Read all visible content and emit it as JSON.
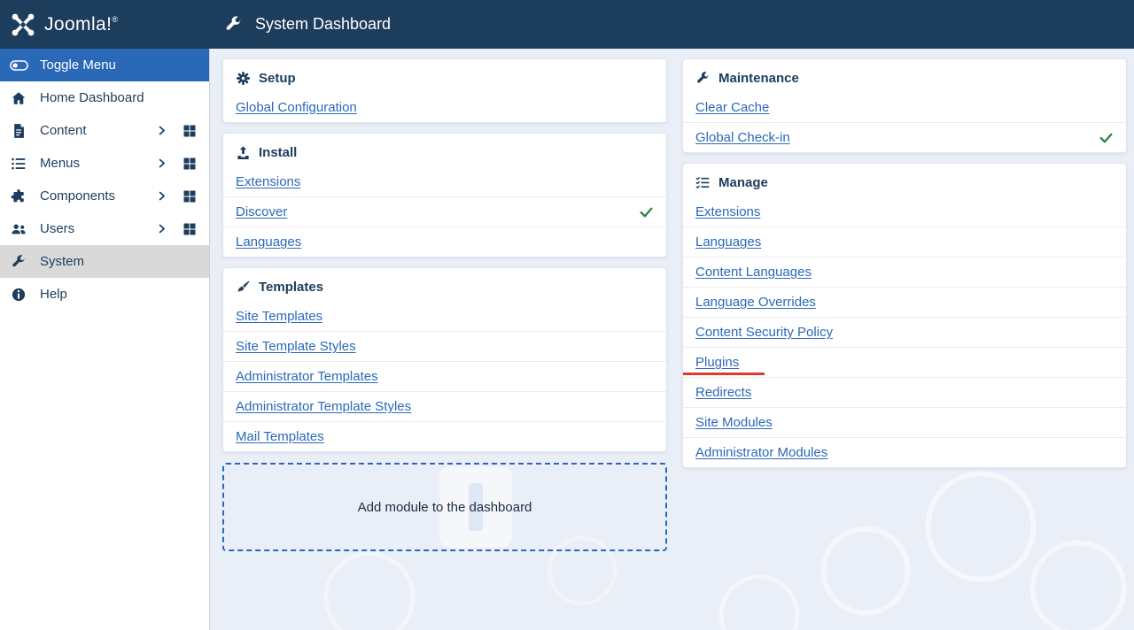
{
  "colors": {
    "navy": "#1c3d5c",
    "accent_blue": "#2a69b8",
    "success_green": "#2f8540",
    "annotation_red": "#df3a2b",
    "page_background": "#e9eef7",
    "active_item_gray": "#d9d9d9"
  },
  "header": {
    "logo_text": "Joomla!",
    "logo_reg": "®",
    "title": "System Dashboard",
    "title_icon": "wrench-icon"
  },
  "sidebar": {
    "items": [
      {
        "label": "Toggle Menu",
        "icon": "toggle-icon"
      },
      {
        "label": "Home Dashboard",
        "icon": "home-icon"
      },
      {
        "label": "Content",
        "icon": "document-icon",
        "has_submenu": true
      },
      {
        "label": "Menus",
        "icon": "list-icon",
        "has_submenu": true
      },
      {
        "label": "Components",
        "icon": "puzzle-icon",
        "has_submenu": true
      },
      {
        "label": "Users",
        "icon": "users-icon",
        "has_submenu": true
      },
      {
        "label": "System",
        "icon": "wrench-icon",
        "active": true
      },
      {
        "label": "Help",
        "icon": "info-icon"
      }
    ]
  },
  "panels": {
    "setup": {
      "title": "Setup",
      "icon": "gear-icon",
      "links": [
        {
          "label": "Global Configuration"
        }
      ]
    },
    "install": {
      "title": "Install",
      "icon": "upload-icon",
      "links": [
        {
          "label": "Extensions"
        },
        {
          "label": "Discover",
          "checked": true
        },
        {
          "label": "Languages"
        }
      ]
    },
    "templates": {
      "title": "Templates",
      "icon": "brush-icon",
      "links": [
        {
          "label": "Site Templates"
        },
        {
          "label": "Site Template Styles"
        },
        {
          "label": "Administrator Templates"
        },
        {
          "label": "Administrator Template Styles"
        },
        {
          "label": "Mail Templates"
        }
      ]
    },
    "maintenance": {
      "title": "Maintenance",
      "icon": "wrench-icon",
      "links": [
        {
          "label": "Clear Cache"
        },
        {
          "label": "Global Check-in",
          "checked": true
        }
      ]
    },
    "manage": {
      "title": "Manage",
      "icon": "list-check-icon",
      "links": [
        {
          "label": "Extensions"
        },
        {
          "label": "Languages"
        },
        {
          "label": "Content Languages"
        },
        {
          "label": "Language Overrides"
        },
        {
          "label": "Content Security Policy"
        },
        {
          "label": "Plugins",
          "marked": true
        },
        {
          "label": "Redirects"
        },
        {
          "label": "Site Modules"
        },
        {
          "label": "Administrator Modules"
        }
      ]
    }
  },
  "add_module": {
    "label": "Add module to the dashboard"
  }
}
